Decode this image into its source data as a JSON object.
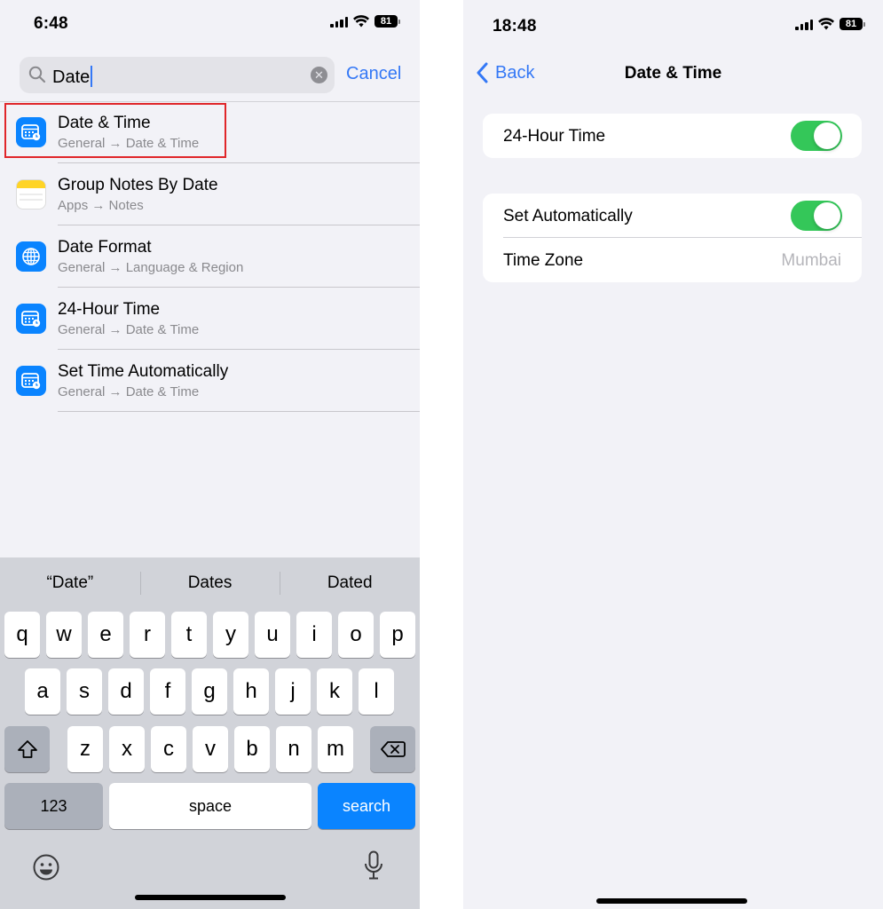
{
  "left": {
    "status": {
      "time": "6:48",
      "battery": "81"
    },
    "search": {
      "query": "Date"
    },
    "cancel_label": "Cancel",
    "results": [
      {
        "title": "Date & Time",
        "subtitle": "General → Date & Time",
        "icon": "date-time-icon"
      },
      {
        "title": "Group Notes By Date",
        "subtitle": "Apps → Notes",
        "icon": "notes-icon"
      },
      {
        "title": "Date Format",
        "subtitle": "General → Language & Region",
        "icon": "globe-icon"
      },
      {
        "title": "24-Hour Time",
        "subtitle": "General → Date & Time",
        "icon": "date-time-icon"
      },
      {
        "title": "Set Time Automatically",
        "subtitle": "General → Date & Time",
        "icon": "date-time-icon"
      }
    ],
    "keyboard": {
      "suggestions": [
        "“Date”",
        "Dates",
        "Dated"
      ],
      "row1": [
        "q",
        "w",
        "e",
        "r",
        "t",
        "y",
        "u",
        "i",
        "o",
        "p"
      ],
      "row2": [
        "a",
        "s",
        "d",
        "f",
        "g",
        "h",
        "j",
        "k",
        "l"
      ],
      "row3": [
        "z",
        "x",
        "c",
        "v",
        "b",
        "n",
        "m"
      ],
      "numbers_label": "123",
      "space_label": "space",
      "search_label": "search"
    }
  },
  "right": {
    "status": {
      "time": "18:48",
      "battery": "81"
    },
    "nav": {
      "back_label": "Back",
      "title": "Date & Time"
    },
    "group1": {
      "label": "24-Hour Time",
      "toggle_on": true
    },
    "group2": {
      "set_auto_label": "Set Automatically",
      "set_auto_on": true,
      "time_zone_label": "Time Zone",
      "time_zone_value": "Mumbai"
    }
  },
  "colors": {
    "accent": "#3478f6",
    "toggle_on": "#34c759",
    "highlight": "#e0262a"
  }
}
